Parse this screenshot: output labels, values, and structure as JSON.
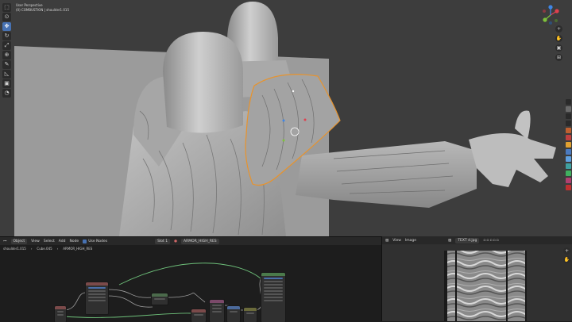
{
  "viewport": {
    "perspective_label": "User Perspective",
    "object_label": "(0) COMBUSTION | shoulder1.015"
  },
  "toolbar": {
    "tools": [
      {
        "name": "select-box",
        "glyph": "⬚",
        "active": false
      },
      {
        "name": "cursor",
        "glyph": "⊙",
        "active": false
      },
      {
        "name": "move",
        "glyph": "✥",
        "active": true
      },
      {
        "name": "rotate",
        "glyph": "↻",
        "active": false
      },
      {
        "name": "scale",
        "glyph": "⤢",
        "active": false
      },
      {
        "name": "transform",
        "glyph": "⊕",
        "active": false
      },
      {
        "name": "annotate",
        "glyph": "✎",
        "active": false
      },
      {
        "name": "measure",
        "glyph": "◺",
        "active": false
      },
      {
        "name": "add-cube",
        "glyph": "▣",
        "active": false
      },
      {
        "name": "sculpt",
        "glyph": "◔",
        "active": false
      }
    ]
  },
  "gizmo": {
    "axis_colors": {
      "x": "#e0404f",
      "y": "#7ec23b",
      "z": "#3f86e6"
    }
  },
  "nav_buttons": [
    {
      "name": "zoom",
      "glyph": "+"
    },
    {
      "name": "pan",
      "glyph": "✋"
    },
    {
      "name": "camera",
      "glyph": "▣"
    },
    {
      "name": "grid",
      "glyph": "⊞"
    }
  ],
  "node_editor": {
    "header": {
      "editor_type_glyph": "⊶",
      "object_menu": "Object",
      "menus": [
        "View",
        "Select",
        "Add",
        "Node"
      ],
      "use_nodes_label": "Use Nodes",
      "slot_label": "Slot 1",
      "material_name": "ARMOR_HIGH_RES"
    },
    "breadcrumb": [
      "shoulder1.015",
      "Cube.045",
      "ARMOR_HIGH_RES"
    ]
  },
  "image_editor": {
    "header": {
      "editor_type_glyph": "▨",
      "menus": [
        "View",
        "Image"
      ],
      "image_name": "TEXT d.jpg"
    }
  }
}
